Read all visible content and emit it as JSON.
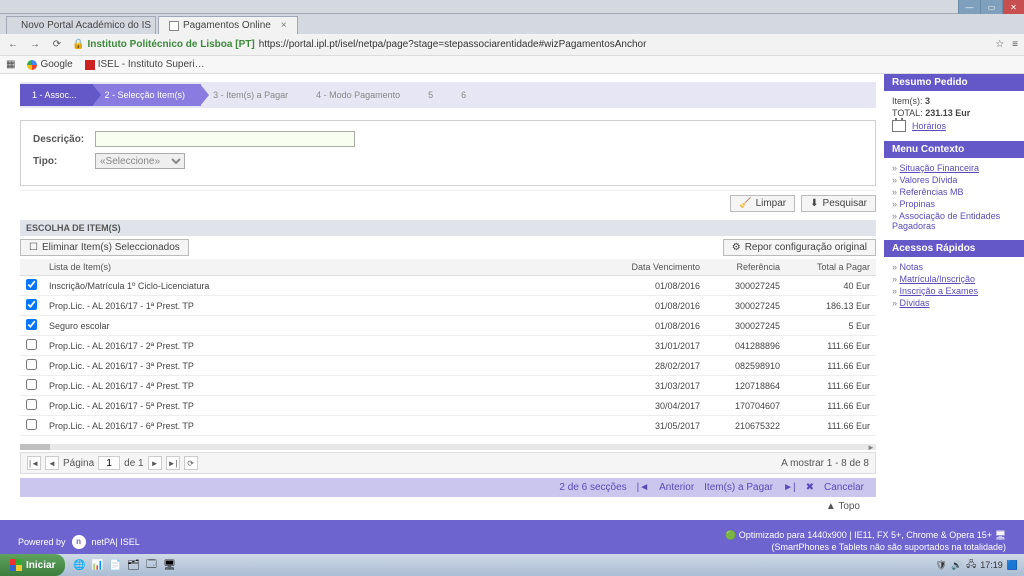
{
  "browser": {
    "tabs": [
      {
        "title": "Novo Portal Académico do IS"
      },
      {
        "title": "Pagamentos Online"
      }
    ],
    "nav": {
      "back": "←",
      "fwd": "→",
      "reload": "⟳"
    },
    "secure_label": "Instituto Politécnico de Lisboa [PT]",
    "url_rest": "https://portal.ipl.pt/isel/netpa/page?stage=stepassociarentidade#wizPagamentosAnchor",
    "bookmarks": [
      {
        "label": "Google"
      },
      {
        "label": "ISEL - Instituto Superi…"
      }
    ]
  },
  "wizard": [
    {
      "label": "1 - Assoc...",
      "state": "done"
    },
    {
      "label": "2 - Selecção Item(s)",
      "state": "active"
    },
    {
      "label": "3 - Item(s) a Pagar",
      "state": ""
    },
    {
      "label": "4 - Modo Pagamento",
      "state": ""
    },
    {
      "label": "5",
      "state": ""
    },
    {
      "label": "6",
      "state": ""
    }
  ],
  "filter": {
    "desc_label": "Descrição:",
    "tipo_label": "Tipo:",
    "tipo_placeholder": "«Seleccione»",
    "limpar": "Limpar",
    "pesquisar": "Pesquisar"
  },
  "section_title": "ESCOLHA DE ITEM(S)",
  "toolbar": {
    "eliminar": "Eliminar Item(s) Seleccionados",
    "repor": "Repor configuração original"
  },
  "grid": {
    "headers": {
      "lista": "Lista de Item(s)",
      "data": "Data Vencimento",
      "ref": "Referência",
      "total": "Total a Pagar"
    },
    "rows": [
      {
        "sel": true,
        "lista": "Inscrição/Matrícula 1º Ciclo-Licenciatura",
        "data": "01/08/2016",
        "ref": "300027245",
        "total": "40 Eur"
      },
      {
        "sel": true,
        "lista": "Prop.Lic. - AL 2016/17 - 1ª Prest. TP",
        "data": "01/08/2016",
        "ref": "300027245",
        "total": "186.13 Eur"
      },
      {
        "sel": true,
        "lista": "Seguro escolar",
        "data": "01/08/2016",
        "ref": "300027245",
        "total": "5 Eur"
      },
      {
        "sel": false,
        "lista": "Prop.Lic. - AL 2016/17 - 2ª Prest. TP",
        "data": "31/01/2017",
        "ref": "041288896",
        "total": "111.66 Eur"
      },
      {
        "sel": false,
        "lista": "Prop.Lic. - AL 2016/17 - 3ª Prest. TP",
        "data": "28/02/2017",
        "ref": "082598910",
        "total": "111.66 Eur"
      },
      {
        "sel": false,
        "lista": "Prop.Lic. - AL 2016/17 - 4ª Prest. TP",
        "data": "31/03/2017",
        "ref": "120718864",
        "total": "111.66 Eur"
      },
      {
        "sel": false,
        "lista": "Prop.Lic. - AL 2016/17 - 5ª Prest. TP",
        "data": "30/04/2017",
        "ref": "170704607",
        "total": "111.66 Eur"
      },
      {
        "sel": false,
        "lista": "Prop.Lic. - AL 2016/17 - 6ª Prest. TP",
        "data": "31/05/2017",
        "ref": "210675322",
        "total": "111.66 Eur"
      }
    ]
  },
  "pager": {
    "pagina": "Página",
    "num": "1",
    "de": "de 1",
    "status": "A mostrar 1 - 8 de 8"
  },
  "bottombar": {
    "sections": "2 de 6 secções",
    "anterior": "Anterior",
    "itens": "Item(s) a Pagar",
    "cancelar": "Cancelar"
  },
  "topo": "Topo",
  "sidebar": {
    "resumo_title": "Resumo Pedido",
    "items_label": "Item(s):",
    "items_val": "3",
    "total_label": "TOTAL:",
    "total_val": "231.13 Eur",
    "horarios": "Horários",
    "menu_title": "Menu Contexto",
    "menu_items": [
      "Situação Financeira",
      "Valores Dívida",
      "Referências MB",
      "Propinas",
      "Associação de Entidades Pagadoras"
    ],
    "acessos_title": "Acessos Rápidos",
    "acessos_items": [
      "Notas",
      "Matrícula/Inscrição",
      "Inscrição a Exames",
      "Dívidas"
    ]
  },
  "footer": {
    "powered": "Powered by",
    "product": "netPA| ISEL",
    "opt": "Optimizado para 1440x900 | IE11, FX 5+, Chrome & Opera 15+",
    "note": "(SmartPhones e Tablets não são suportados na totalidade)"
  },
  "taskbar": {
    "start": "Iniciar",
    "clock": "17:19"
  }
}
